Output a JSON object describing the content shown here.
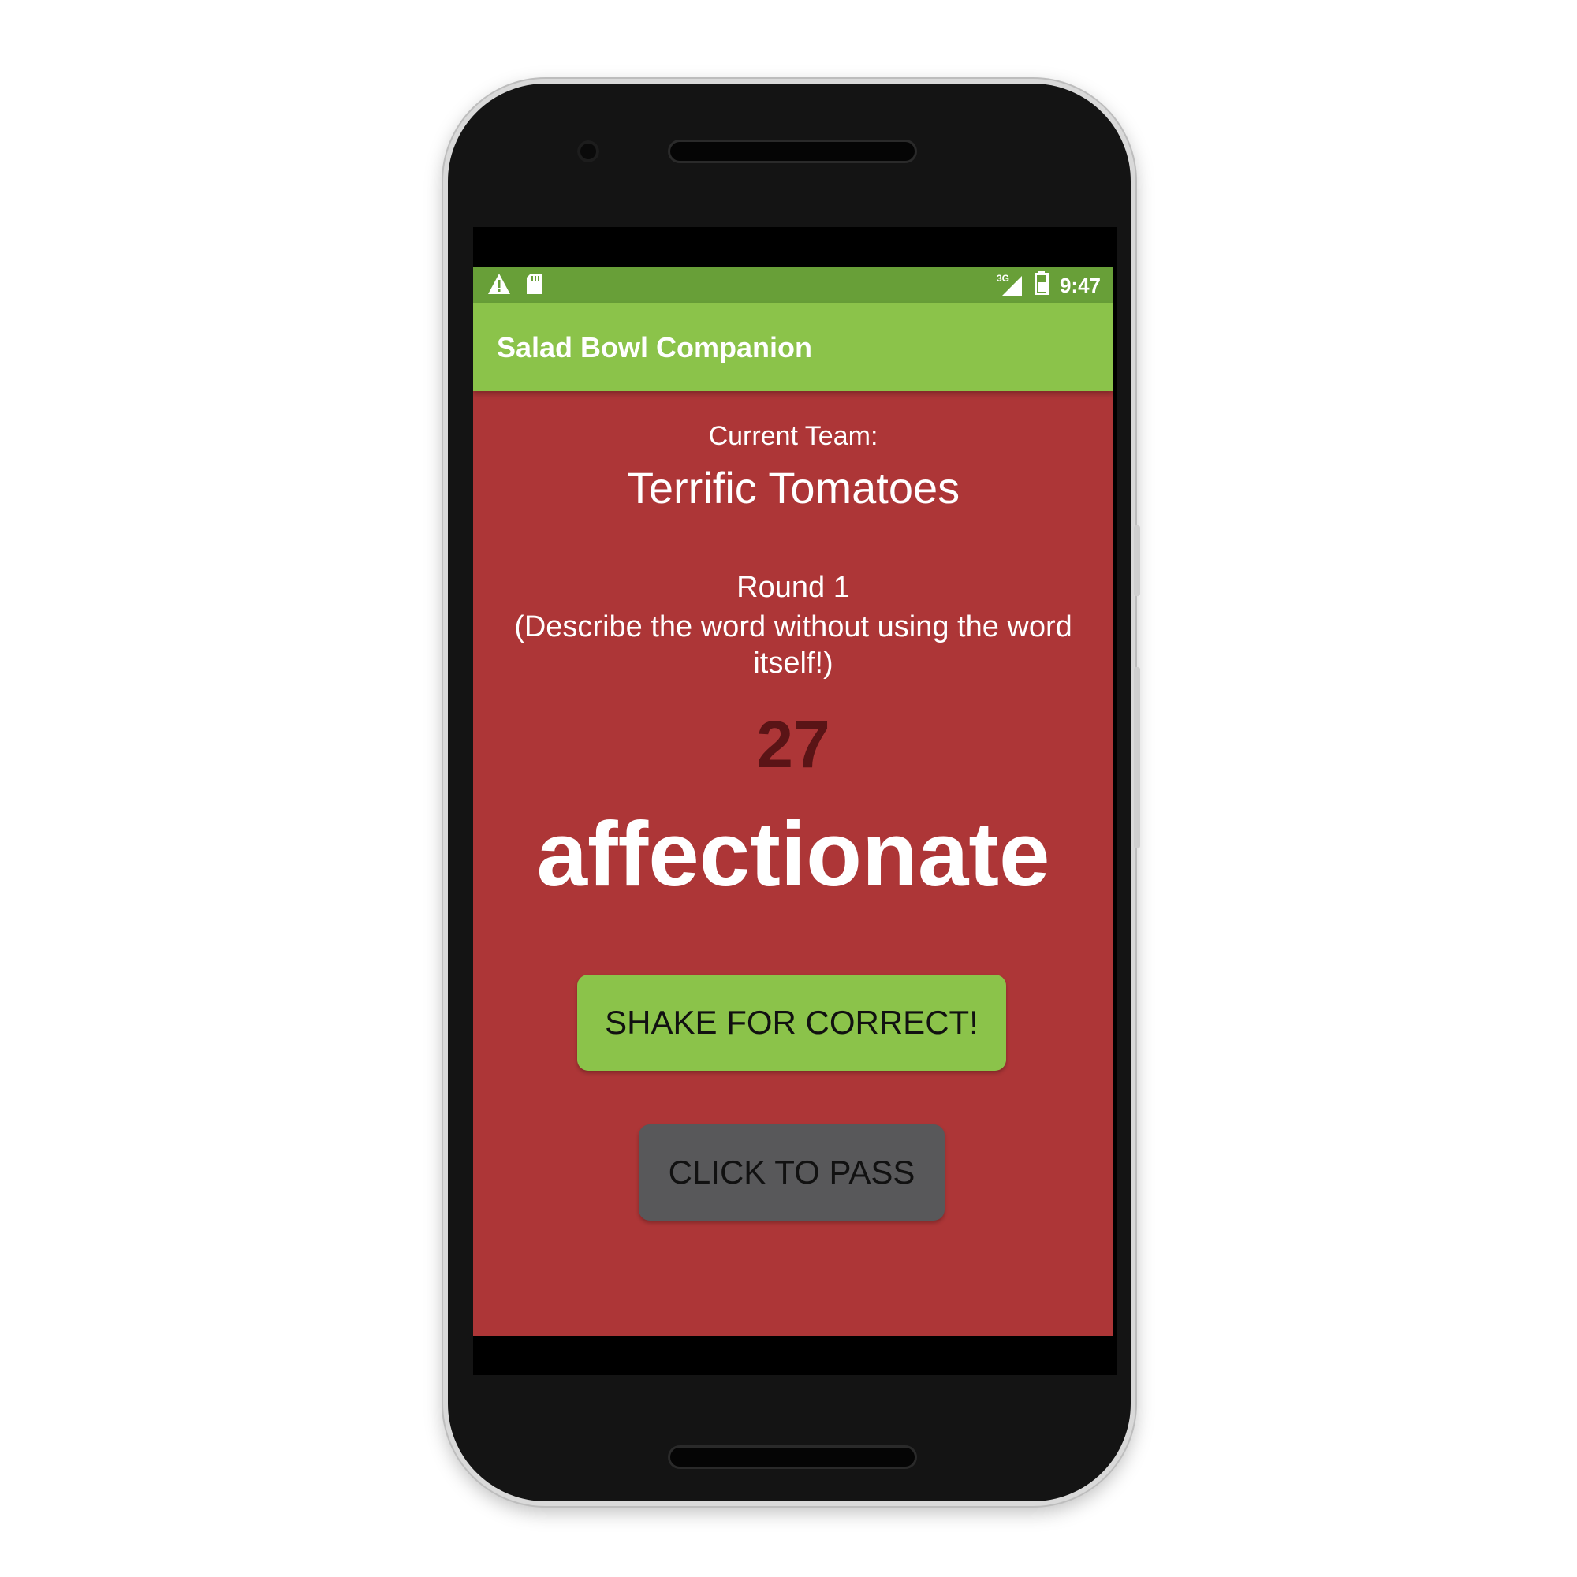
{
  "status_bar": {
    "time": "9:47",
    "network": "3G",
    "left_icons": [
      "warning-icon",
      "sd-card-icon"
    ],
    "right_icons": [
      "signal-icon",
      "battery-icon"
    ]
  },
  "app_bar": {
    "title": "Salad Bowl Companion"
  },
  "game": {
    "team_label": "Current Team:",
    "team_name": "Terrific Tomatoes",
    "round_label": "Round 1",
    "round_hint": "(Describe the word without using the word itself!)",
    "timer": "27",
    "word": "affectionate"
  },
  "buttons": {
    "correct_label": "SHAKE FOR CORRECT!",
    "pass_label": "CLICK TO PASS"
  },
  "colors": {
    "content_background": "#ad3637",
    "app_bar": "#8bc34a",
    "status_bar": "#689f38",
    "correct_button": "#8bc34a",
    "pass_button": "#58585a",
    "timer_text": "#5a1416"
  }
}
